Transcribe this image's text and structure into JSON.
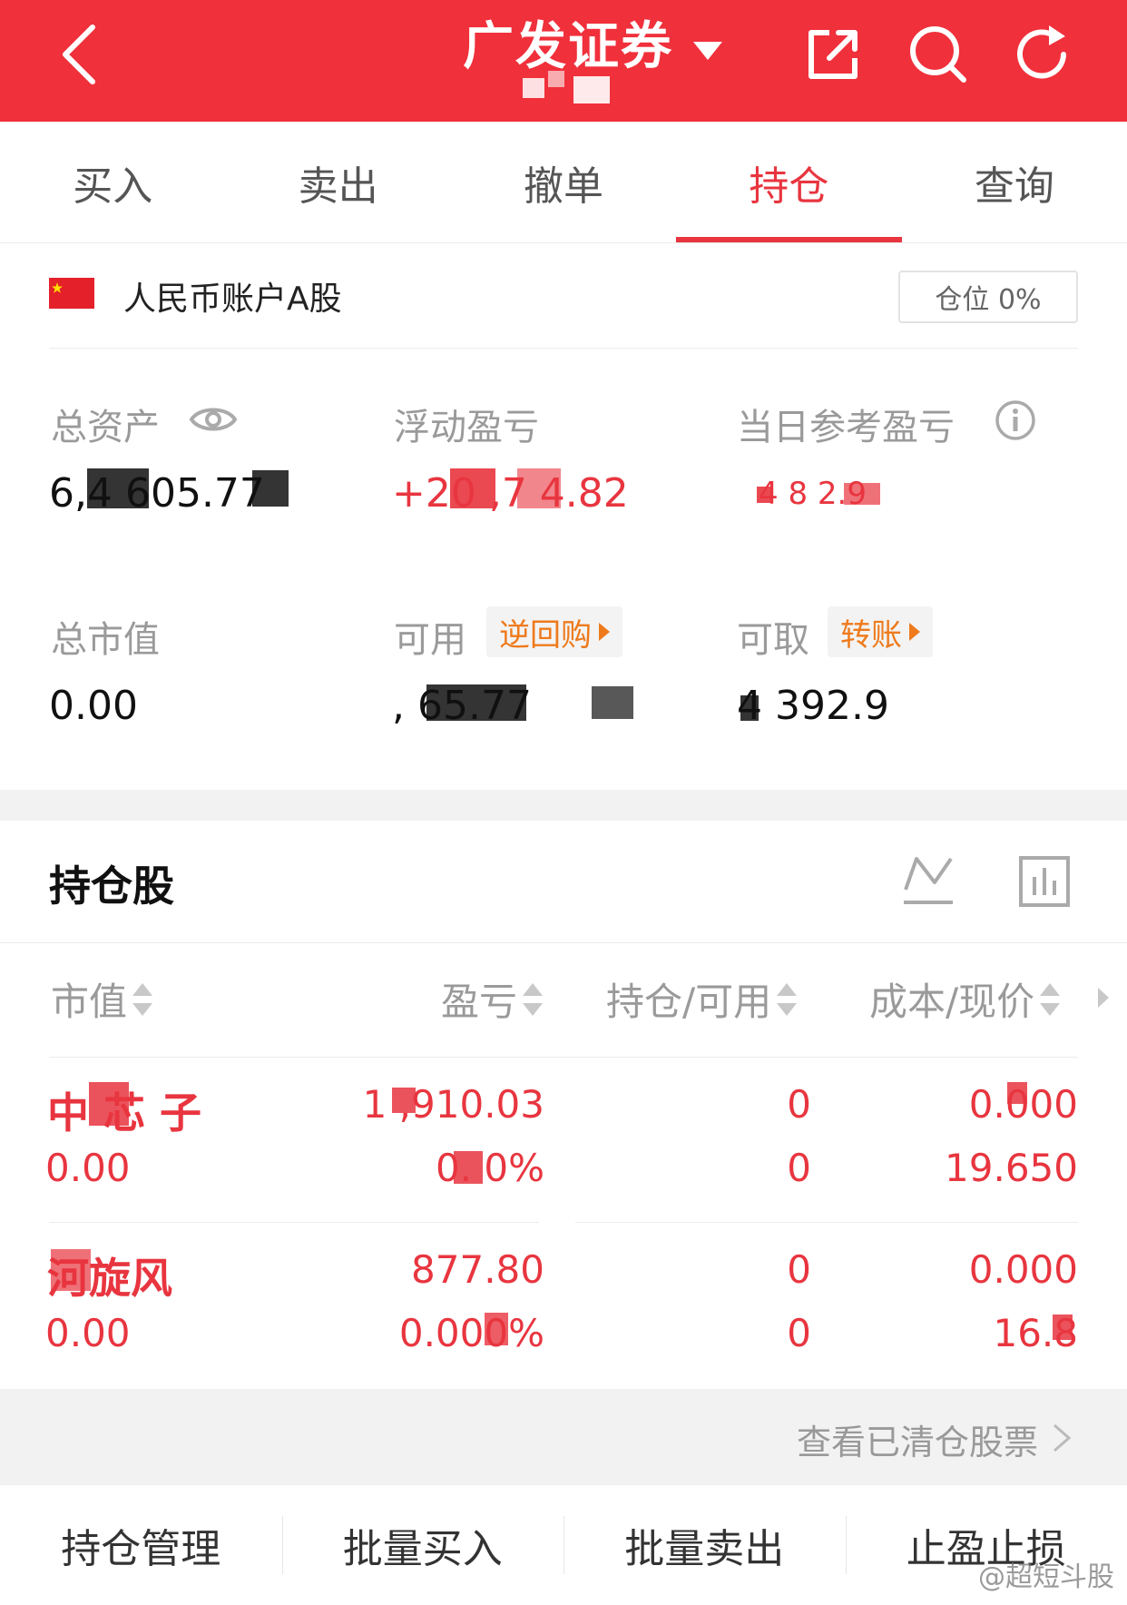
{
  "header": {
    "broker_name": "广发证券",
    "icons": [
      "back-arrow-icon",
      "chevron-down-icon",
      "share-icon",
      "search-icon",
      "refresh-icon"
    ],
    "color": "#f0303b"
  },
  "tabs": [
    {
      "label": "买入",
      "active": false
    },
    {
      "label": "卖出",
      "active": false
    },
    {
      "label": "撤单",
      "active": false
    },
    {
      "label": "持仓",
      "active": true
    },
    {
      "label": "查询",
      "active": false
    }
  ],
  "account": {
    "name": "人民币账户A股",
    "position_label": "仓位 0%"
  },
  "summary": {
    "total_assets_label": "总资产",
    "total_assets_value": "6,4  605.77",
    "float_pnl_label": "浮动盈亏",
    "float_pnl_value": "+20 ,7 4.82",
    "today_pnl_label": "当日参考盈亏",
    "today_pnl_value": "4  8  2.9",
    "market_value_label": "总市值",
    "market_value_value": "0.00",
    "available_label": "可用",
    "available_link": "逆回购",
    "available_value": ",  65.77",
    "withdrawable_label": "可取",
    "withdrawable_link": "转账",
    "withdrawable_value": "4 392.9"
  },
  "holdings": {
    "title": "持仓股",
    "columns": [
      "市值",
      "盈亏",
      "持仓/可用",
      "成本/现价"
    ],
    "rows": [
      {
        "name": "中 芯 子",
        "market_value": "0.00",
        "pnl": "1 ,910.03",
        "pnl_pct": "0.  0%",
        "hold": "0",
        "avail": "0",
        "cost": "0.000",
        "price": "19.650"
      },
      {
        "name": " 河旋风",
        "market_value": "0.00",
        "pnl": " 877.80",
        "pnl_pct": "0.000%",
        "hold": "0",
        "avail": "0",
        "cost": "0.000",
        "price": "16.8 "
      }
    ]
  },
  "cleared_link": "查看已清仓股票",
  "bottom_bar": [
    "持仓管理",
    "批量买入",
    "批量卖出",
    "止盈止损"
  ],
  "watermark": "@超短斗股"
}
